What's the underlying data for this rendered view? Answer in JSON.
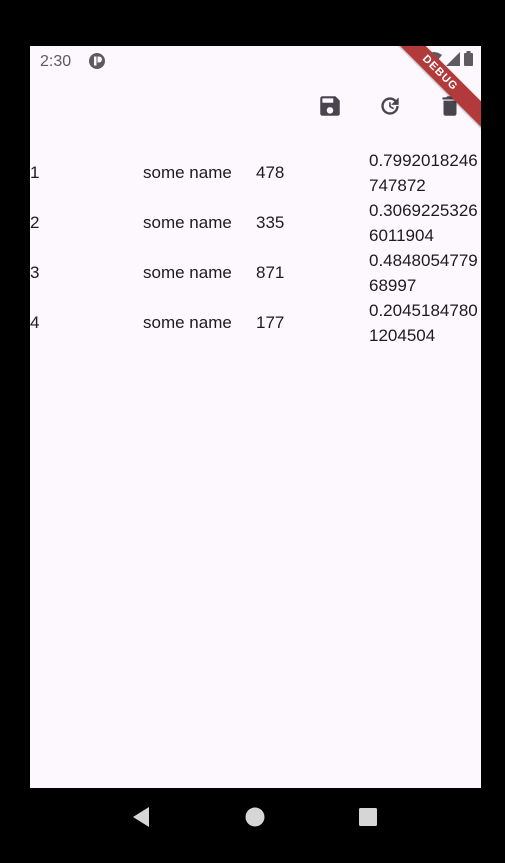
{
  "status": {
    "time": "2:30"
  },
  "app_bar": {
    "actions": [
      "save-icon",
      "refresh-icon",
      "delete-icon"
    ]
  },
  "rows": [
    {
      "id": "1",
      "name": "some name",
      "value": "478",
      "random": "0.7992018246747872"
    },
    {
      "id": "2",
      "name": "some name",
      "value": "335",
      "random": "0.30692253266011904"
    },
    {
      "id": "3",
      "name": "some name",
      "value": "871",
      "random": "0.484805477968997"
    },
    {
      "id": "4",
      "name": "some name",
      "value": "177",
      "random": "0.20451847801204504"
    }
  ],
  "debug_banner": "DEBUG",
  "colors": {
    "background": "#fdf7fe",
    "icon": "#49454f",
    "text": "#1d1b20",
    "debug_ribbon": "#b33a3a"
  }
}
